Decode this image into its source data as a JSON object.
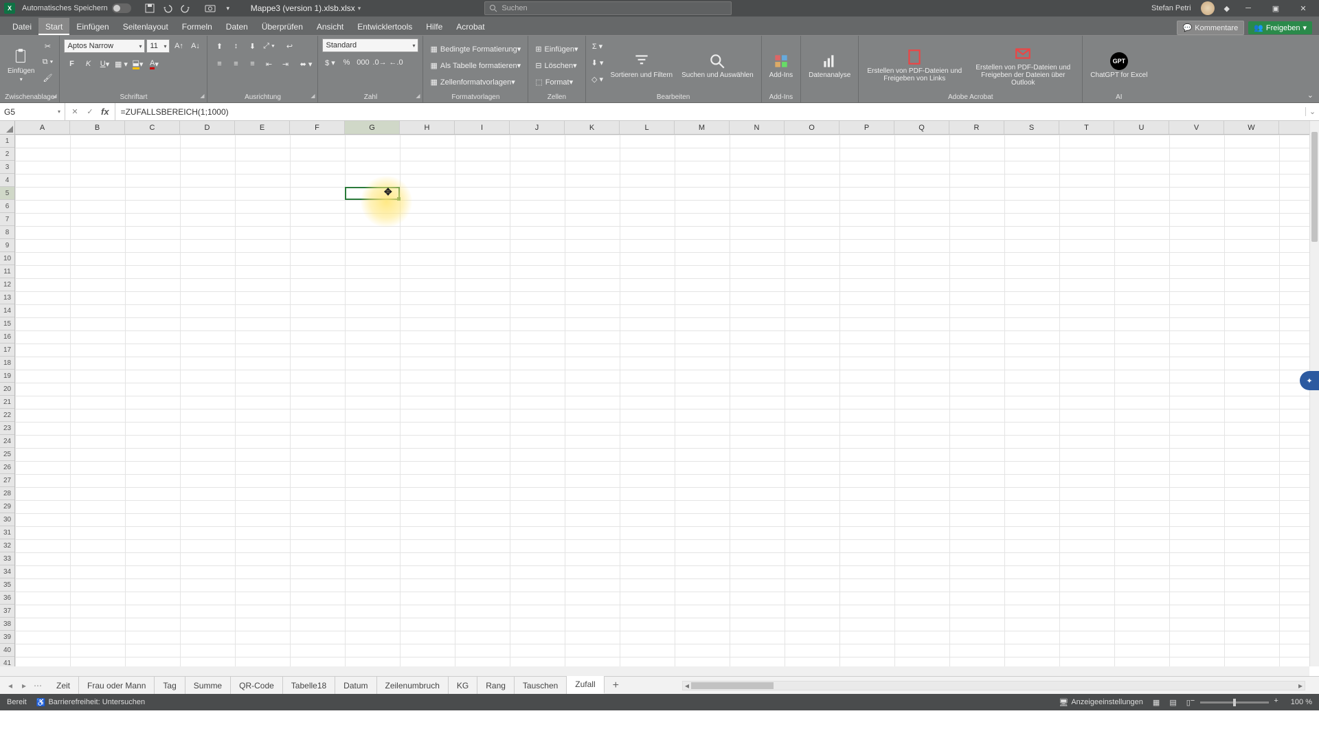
{
  "title_bar": {
    "autosave_label": "Automatisches Speichern",
    "filename": "Mappe3 (version 1).xlsb.xlsx",
    "search_placeholder": "Suchen",
    "user_name": "Stefan Petri"
  },
  "tabs": {
    "items": [
      "Datei",
      "Start",
      "Einfügen",
      "Seitenlayout",
      "Formeln",
      "Daten",
      "Überprüfen",
      "Ansicht",
      "Entwicklertools",
      "Hilfe",
      "Acrobat"
    ],
    "active_index": 1,
    "comments": "Kommentare",
    "share": "Freigeben"
  },
  "ribbon": {
    "clipboard": {
      "paste": "Einfügen",
      "label": "Zwischenablage"
    },
    "font": {
      "name": "Aptos Narrow",
      "size": "11",
      "label": "Schriftart"
    },
    "align": {
      "label": "Ausrichtung"
    },
    "number": {
      "format": "Standard",
      "label": "Zahl"
    },
    "styles": {
      "cond": "Bedingte Formatierung",
      "table": "Als Tabelle formatieren",
      "cell": "Zellenformatvorlagen",
      "label": "Formatvorlagen"
    },
    "cells": {
      "insert": "Einfügen",
      "delete": "Löschen",
      "format": "Format",
      "label": "Zellen"
    },
    "editing": {
      "sort": "Sortieren und Filtern",
      "find": "Suchen und Auswählen",
      "label": "Bearbeiten"
    },
    "addins": {
      "btn": "Add-Ins",
      "label": "Add-Ins"
    },
    "data_analysis": "Datenanalyse",
    "acrobat": {
      "pdf1": "Erstellen von PDF-Dateien und Freigeben von Links",
      "pdf2": "Erstellen von PDF-Dateien und Freigeben der Dateien über Outlook",
      "label": "Adobe Acrobat"
    },
    "ai": {
      "gpt": "ChatGPT for Excel",
      "label": "AI"
    }
  },
  "namebox": "G5",
  "formula": "=ZUFALLSBEREICH(1;1000)",
  "columns": [
    "A",
    "B",
    "C",
    "D",
    "E",
    "F",
    "G",
    "H",
    "I",
    "J",
    "K",
    "L",
    "M",
    "N",
    "O",
    "P",
    "Q",
    "R",
    "S",
    "T",
    "U",
    "V",
    "W"
  ],
  "row_count": 41,
  "selected_col": 6,
  "selected_row": 5,
  "sheets": {
    "items": [
      "Zeit",
      "Frau oder Mann",
      "Tag",
      "Summe",
      "QR-Code",
      "Tabelle18",
      "Datum",
      "Zeilenumbruch",
      "KG",
      "Rang",
      "Tauschen",
      "Zufall"
    ],
    "active_index": 11
  },
  "status": {
    "ready": "Bereit",
    "acc": "Barrierefreiheit: Untersuchen",
    "display": "Anzeigeeinstellungen",
    "zoom": "100 %"
  }
}
